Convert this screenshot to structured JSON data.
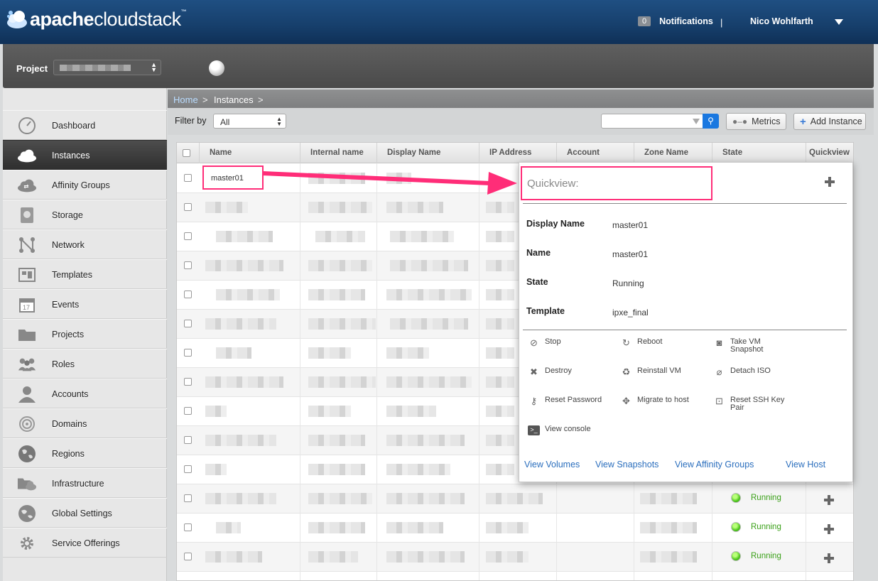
{
  "header": {
    "logo_bold": "apache",
    "logo_light": "cloudstack",
    "logo_tm": "™",
    "notifications_count": "0",
    "notifications_label": "Notifications",
    "separator": "|",
    "user_name": "Nico Wohlfarth"
  },
  "project_bar": {
    "label": "Project"
  },
  "sidebar": {
    "items": [
      {
        "label": "Dashboard",
        "icon": "dashboard-icon"
      },
      {
        "label": "Instances",
        "icon": "cloud-icon"
      },
      {
        "label": "Affinity Groups",
        "icon": "affinity-icon"
      },
      {
        "label": "Storage",
        "icon": "storage-icon"
      },
      {
        "label": "Network",
        "icon": "network-icon"
      },
      {
        "label": "Templates",
        "icon": "templates-icon"
      },
      {
        "label": "Events",
        "icon": "calendar-icon"
      },
      {
        "label": "Projects",
        "icon": "folder-icon"
      },
      {
        "label": "Roles",
        "icon": "roles-icon"
      },
      {
        "label": "Accounts",
        "icon": "account-icon"
      },
      {
        "label": "Domains",
        "icon": "domains-icon"
      },
      {
        "label": "Regions",
        "icon": "globe-icon"
      },
      {
        "label": "Infrastructure",
        "icon": "infrastructure-icon"
      },
      {
        "label": "Global Settings",
        "icon": "globe-settings-icon"
      },
      {
        "label": "Service Offerings",
        "icon": "gear-icon"
      }
    ],
    "active_index": 1,
    "events_icon_day": "17"
  },
  "breadcrumb": {
    "home": "Home",
    "sep": ">",
    "current": "Instances"
  },
  "toolbar": {
    "filter_label": "Filter by",
    "filter_value": "All",
    "metrics_label": "Metrics",
    "add_label": "Add Instance"
  },
  "table": {
    "columns": [
      "Name",
      "Internal name",
      "Display Name",
      "IP Address",
      "Account",
      "Zone Name",
      "State",
      "Quickview"
    ],
    "first_row_name": "master01",
    "visible_states": [
      "Running",
      "Running",
      "Running"
    ]
  },
  "quickview": {
    "title": "Quickview:",
    "fields": [
      {
        "label": "Display Name",
        "value": "master01"
      },
      {
        "label": "Name",
        "value": "master01"
      },
      {
        "label": "State",
        "value": "Running"
      },
      {
        "label": "Template",
        "value": "ipxe_final"
      }
    ],
    "actions": [
      {
        "label": "Stop",
        "icon": "stop-icon"
      },
      {
        "label": "Reboot",
        "icon": "reboot-icon"
      },
      {
        "label": "Take VM\nSnapshot",
        "icon": "camera-icon"
      },
      {
        "label": "Destroy",
        "icon": "destroy-icon"
      },
      {
        "label": "Reinstall VM",
        "icon": "recycle-icon"
      },
      {
        "label": "Detach ISO",
        "icon": "detach-iso-icon"
      },
      {
        "label": "Reset Password",
        "icon": "key-icon"
      },
      {
        "label": "Migrate to host",
        "icon": "migrate-icon"
      },
      {
        "label": "Reset SSH Key\nPair",
        "icon": "ssh-key-icon"
      },
      {
        "label": "View console",
        "icon": "console-icon"
      }
    ],
    "links": [
      "View Volumes",
      "View Snapshots",
      "View Affinity Groups",
      "View Host"
    ]
  },
  "colors": {
    "header_blue": "#17406d",
    "highlight_pink": "#ff2d78",
    "running_green": "#3aa018",
    "link_blue": "#2a6ebd"
  }
}
